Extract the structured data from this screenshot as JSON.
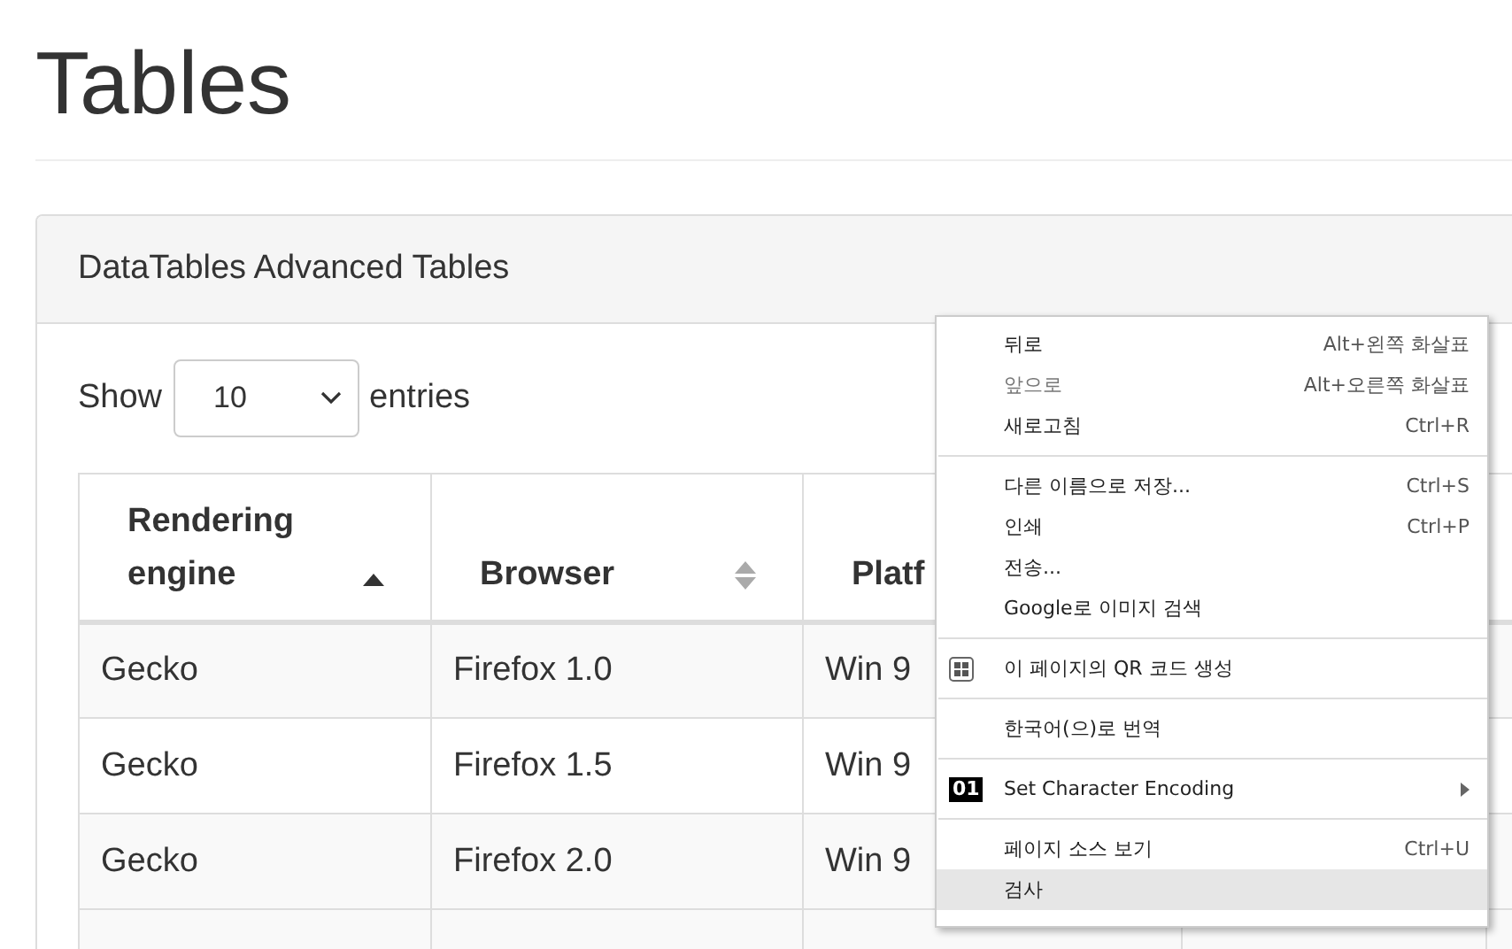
{
  "page_title": "Tables",
  "card": {
    "title": "DataTables Advanced Tables",
    "length": {
      "label_before": "Show",
      "value": "10",
      "label_after": "entries"
    },
    "table": {
      "columns": [
        {
          "label": "Rendering engine",
          "kind": "sorted"
        },
        {
          "label": "Browser",
          "kind": "sortable"
        },
        {
          "label": "Platf",
          "kind": "plain"
        }
      ],
      "rows": [
        [
          "Gecko",
          "Firefox 1.0",
          "Win 9"
        ],
        [
          "Gecko",
          "Firefox 1.5",
          "Win 9"
        ],
        [
          "Gecko",
          "Firefox 2.0",
          "Win 9"
        ]
      ]
    }
  },
  "context_menu": {
    "groups": [
      [
        {
          "label": "뒤로",
          "shortcut": "Alt+왼쪽 화살표",
          "disabled": false,
          "selected": false
        },
        {
          "label": "앞으로",
          "shortcut": "Alt+오른쪽 화살표",
          "disabled": true,
          "selected": false
        },
        {
          "label": "새로고침",
          "shortcut": "Ctrl+R",
          "disabled": false,
          "selected": false
        }
      ],
      [
        {
          "label": "다른 이름으로 저장...",
          "shortcut": "Ctrl+S",
          "disabled": false,
          "selected": false
        },
        {
          "label": "인쇄",
          "shortcut": "Ctrl+P",
          "disabled": false,
          "selected": false
        },
        {
          "label": "전송...",
          "disabled": false,
          "selected": false
        },
        {
          "label": "Google로 이미지 검색",
          "disabled": false,
          "selected": false
        }
      ],
      [
        {
          "label": "이 페이지의 QR 코드 생성",
          "kind": "qr",
          "disabled": false,
          "selected": false
        }
      ],
      [
        {
          "label": "한국어(으)로 번역",
          "disabled": false,
          "selected": false
        }
      ],
      [
        {
          "label": "Set Character Encoding",
          "icon_text": "01",
          "submenu": true,
          "disabled": false,
          "selected": false
        }
      ],
      [
        {
          "label": "페이지 소스 보기",
          "shortcut": "Ctrl+U",
          "disabled": false,
          "selected": false
        },
        {
          "label": "검사",
          "disabled": false,
          "selected": true
        }
      ]
    ]
  }
}
